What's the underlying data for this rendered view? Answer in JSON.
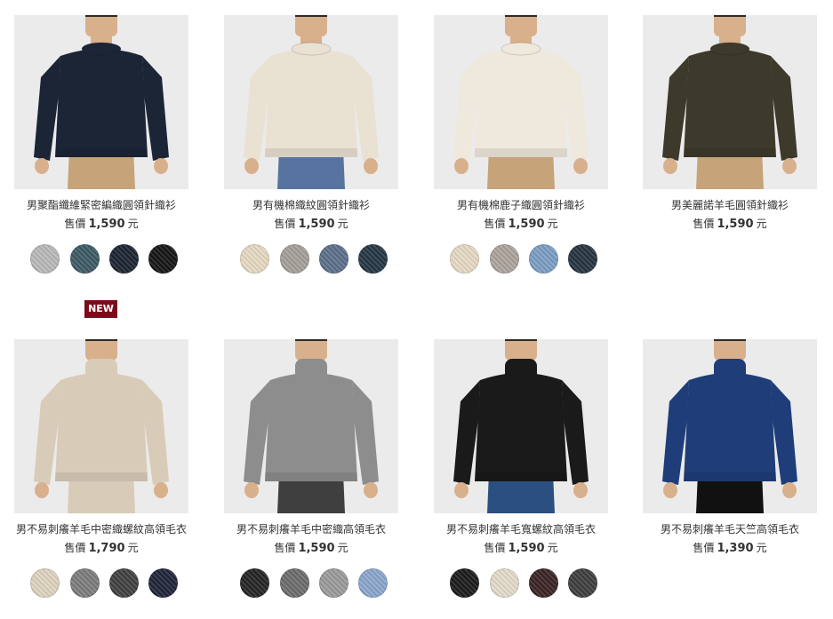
{
  "products": [
    {
      "name": "男聚酯纖維緊密編織圓領針織衫",
      "price_label": "售價",
      "price": "1,590",
      "currency": "元",
      "sweater": "#1c2536",
      "pants": "#c6a378",
      "bg": "#ebebeb",
      "collar": "crew",
      "swatches": [
        "#b9b9b9",
        "#3c5964",
        "#1a2330",
        "#141414"
      ],
      "badge": "NEW"
    },
    {
      "name": "男有機棉織紋圓領針織衫",
      "price_label": "售價",
      "price": "1,590",
      "currency": "元",
      "sweater": "#e9e1d2",
      "pants": "#5774a0",
      "bg": "#ebebeb",
      "collar": "crew",
      "swatches": [
        "#e6d9c2",
        "#a49f99",
        "#5b6e8a",
        "#243643"
      ]
    },
    {
      "name": "男有機棉鹿子織圓領針織衫",
      "price_label": "售價",
      "price": "1,590",
      "currency": "元",
      "sweater": "#efe8dc",
      "pants": "#c6a378",
      "bg": "#ebebeb",
      "collar": "crew",
      "swatches": [
        "#e6d9c4",
        "#aca39c",
        "#7b9dc3",
        "#25343f"
      ]
    },
    {
      "name": "男美麗諾羊毛圓領針織衫",
      "price_label": "售價",
      "price": "1,590",
      "currency": "元",
      "sweater": "#3d3a2c",
      "pants": "#c6a378",
      "bg": "#ebebeb",
      "collar": "crew",
      "swatches": []
    },
    {
      "name": "男不易刺癢羊毛中密織螺紋高領毛衣",
      "price_label": "售價",
      "price": "1,790",
      "currency": "元",
      "sweater": "#d8cbb8",
      "pants": "#d8cbb8",
      "bg": "#ebebeb",
      "collar": "turtle",
      "swatches": [
        "#dfd3bf",
        "#7c7c7c",
        "#404040",
        "#1f2438"
      ]
    },
    {
      "name": "男不易刺癢羊毛中密織高領毛衣",
      "price_label": "售價",
      "price": "1,590",
      "currency": "元",
      "sweater": "#8d8d8d",
      "pants": "#3f3f3f",
      "bg": "#ebebeb",
      "collar": "turtle",
      "swatches": [
        "#242424",
        "#6c6c6c",
        "#9a9a9a",
        "#8aa6cc"
      ]
    },
    {
      "name": "男不易刺癢羊毛寬螺紋高領毛衣",
      "price_label": "售價",
      "price": "1,590",
      "currency": "元",
      "sweater": "#1a1a1a",
      "pants": "#2c4f82",
      "bg": "#ebebeb",
      "collar": "turtle",
      "swatches": [
        "#1a1a1a",
        "#e3dac9",
        "#3a2223",
        "#3d3d3d"
      ]
    },
    {
      "name": "男不易刺癢羊毛天竺高領毛衣",
      "price_label": "售價",
      "price": "1,390",
      "currency": "元",
      "sweater": "#1f3d78",
      "pants": "#111111",
      "bg": "#ebebeb",
      "collar": "turtle",
      "swatches": []
    }
  ]
}
